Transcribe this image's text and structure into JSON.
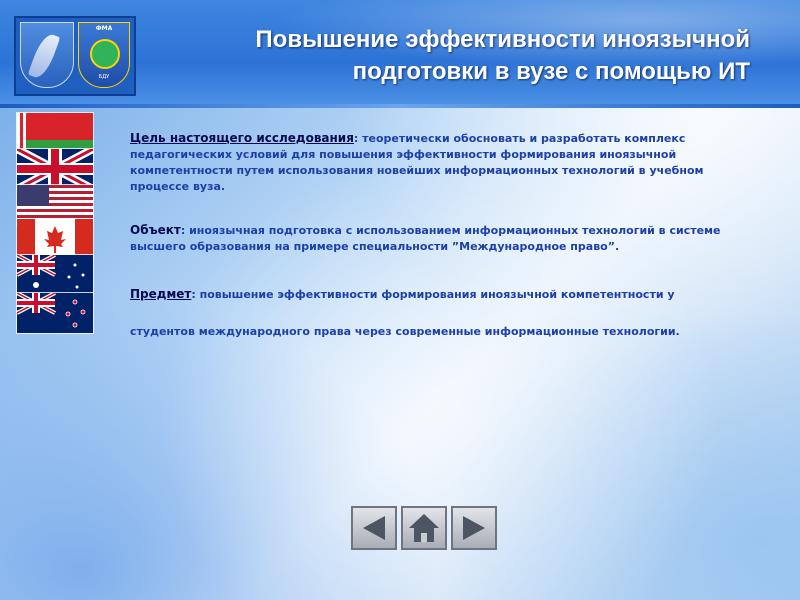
{
  "header": {
    "title_line1": "Повышение эффективности иноязычной",
    "title_line2": "подготовки в вузе с помощью ИТ",
    "logo_right_abbr": "ФМА",
    "logo_right_bottom": "БДУ"
  },
  "flags": [
    {
      "name": "belarus-flag-icon"
    },
    {
      "name": "uk-flag-icon"
    },
    {
      "name": "usa-flag-icon"
    },
    {
      "name": "canada-flag-icon"
    },
    {
      "name": "australia-flag-icon"
    },
    {
      "name": "new-zealand-flag-icon"
    }
  ],
  "content": {
    "goal_label": "Цель настоящего исследования",
    "goal_text": ": теоретически обосновать и разработать комплекс педагогических условий для повышения эффективности формирования иноязычной компетентности путем использования новейших информационных технологий в учебном процессе вуза.",
    "object_label": "Объект",
    "object_text": ": иноязычная подготовка с использованием информационных технологий в системе высшего образования на примере специальности ”Международное право”.",
    "subject_label": "Предмет",
    "subject_text": ": повышение эффективности формирования иноязычной компетентности у",
    "subject_text2": "студентов международного права через современные информационные технологии."
  },
  "navigation": {
    "prev_icon": "triangle-left-icon",
    "home_icon": "home-icon",
    "next_icon": "triangle-right-icon"
  },
  "colors": {
    "header_blue": "#2d73d6",
    "text_blue": "#1c3fa8",
    "label_navy": "#0a0a50"
  }
}
